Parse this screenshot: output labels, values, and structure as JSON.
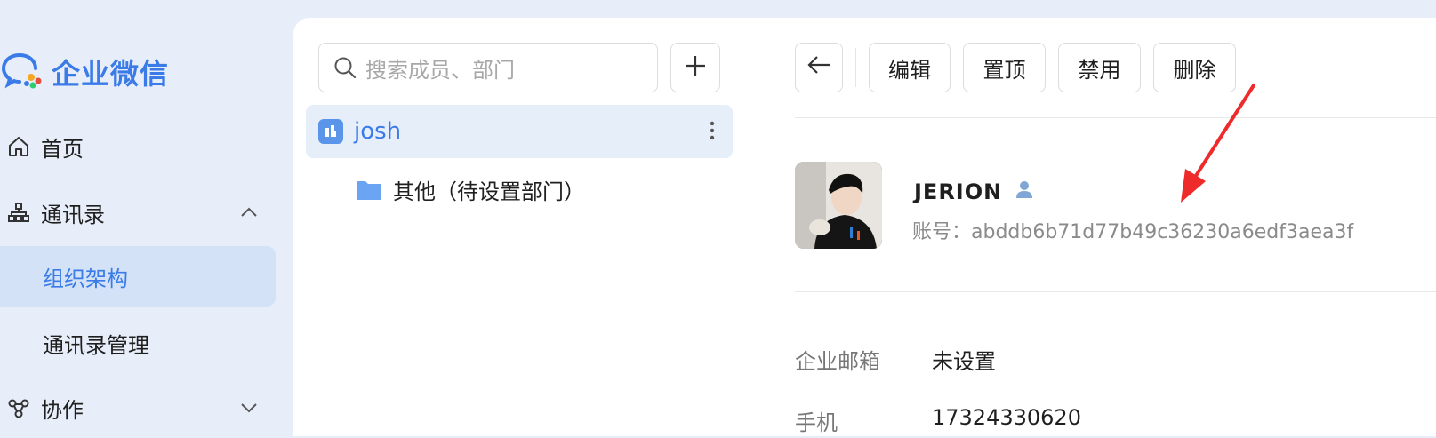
{
  "app": {
    "name": "企业微信"
  },
  "sidebar": {
    "items": [
      {
        "label": "首页"
      },
      {
        "label": "通讯录"
      },
      {
        "label": "组织架构"
      },
      {
        "label": "通讯录管理"
      },
      {
        "label": "协作"
      }
    ]
  },
  "directory": {
    "search_placeholder": "搜索成员、部门",
    "org_name": "josh",
    "dept_name": "其他（待设置部门）"
  },
  "detail": {
    "toolbar": {
      "edit": "编辑",
      "pin": "置顶",
      "disable": "禁用",
      "delete": "删除"
    },
    "user_name": "JERION",
    "account": "账号：abddb6b71d77b49c36230a6edf3aea3f",
    "fields": [
      {
        "label": "企业邮箱",
        "value": "未设置"
      },
      {
        "label": "手机",
        "value": "17324330620"
      }
    ]
  },
  "colors": {
    "accent": "#3a7be8",
    "arrow": "#ee2a2a",
    "active_bg": "#d3e2f7"
  }
}
